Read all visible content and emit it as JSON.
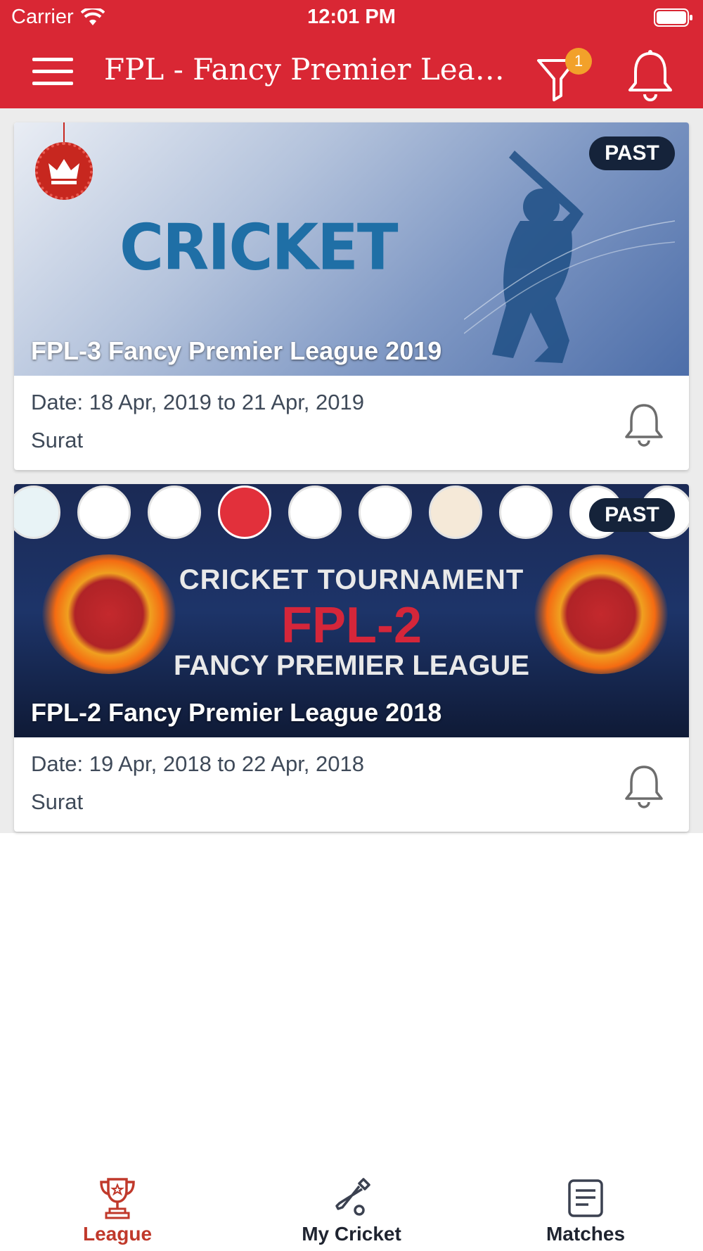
{
  "status_bar": {
    "carrier": "Carrier",
    "time": "12:01 PM"
  },
  "header": {
    "title": "FPL - Fancy Premier League",
    "filter_badge_count": "1",
    "accent_color": "#d92734"
  },
  "leagues": [
    {
      "name": "FPL-3 Fancy Premier League 2019",
      "status": "PAST",
      "date": "Date: 18 Apr, 2019 to 21 Apr, 2019",
      "city": "Surat",
      "banner_text": "CRICKET"
    },
    {
      "name": "FPL-2 Fancy Premier League 2018",
      "status": "PAST",
      "date": "Date: 19 Apr, 2018 to 22 Apr, 2018",
      "city": "Surat",
      "banner_lines": [
        "CRICKET TOURNAMENT",
        "FPL-2",
        "FANCY PREMIER LEAGUE"
      ]
    }
  ],
  "tabs": [
    {
      "label": "League",
      "icon": "trophy-icon",
      "active": true
    },
    {
      "label": "My Cricket",
      "icon": "cricket-bat-icon",
      "active": false
    },
    {
      "label": "Matches",
      "icon": "document-icon",
      "active": false
    }
  ]
}
